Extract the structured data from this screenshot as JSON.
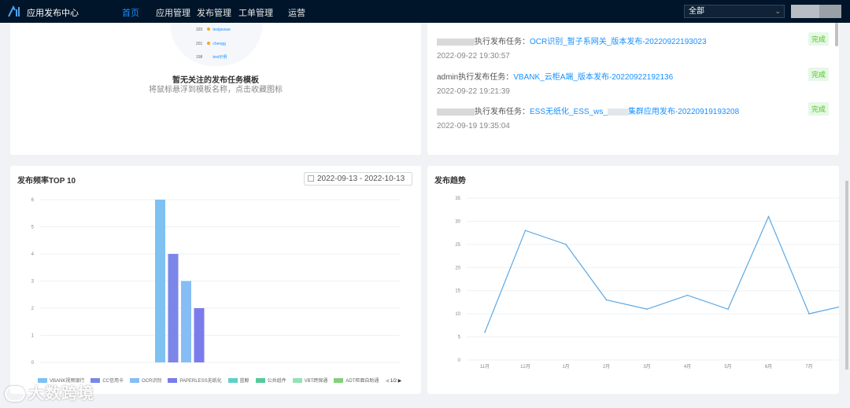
{
  "header": {
    "app_title": "应用发布中心",
    "nav": [
      "首页",
      "应用管理",
      "发布管理",
      "工单管理",
      "运营"
    ],
    "active_nav": "首页",
    "select_value": "全部"
  },
  "illustration": {
    "rows": [
      {
        "num": "320",
        "name": "testjavase"
      },
      {
        "num": "201",
        "name": "chengg"
      },
      {
        "num": "198",
        "name": "test示例"
      }
    ]
  },
  "empty_state": {
    "title": "暂无关注的发布任务模板",
    "subtitle": "将鼠标悬浮到模板名称，点击收藏图标"
  },
  "tasks": [
    {
      "user": "",
      "action": "执行发布任务：",
      "link": "OCR识别_暂子系网关_版本发布-20220922193023",
      "time": "2022-09-22 19:30:57",
      "status": "完成"
    },
    {
      "user": "admin",
      "action": "执行发布任务：",
      "link": "VBANK_云柜A端_版本发布-20220922192136",
      "time": "2022-09-22 19:21:39",
      "status": "完成"
    },
    {
      "user": "",
      "action": "执行发布任务：",
      "link_prefix": "ESS无纸化_ESS_ws_",
      "link_suffix": "集群应用发布-20220919193208",
      "time": "2022-09-19 19:35:04",
      "status": "完成"
    }
  ],
  "top10": {
    "title": "发布频率TOP 10",
    "date_range": "2022-09-13 - 2022-10-13",
    "pager": "1/2"
  },
  "trend": {
    "title": "发布趋势"
  },
  "chart_data": [
    {
      "type": "bar",
      "title": "发布频率TOP 10",
      "categories": [
        "VBANK视频银行",
        "CC信用卡",
        "OCR识别",
        "PAPERLESS无纸化",
        "蓝鲸",
        "公共组件",
        "VBT跨保通",
        "ADT柜面自助通"
      ],
      "values": [
        6,
        4,
        3,
        2,
        null,
        null,
        null,
        null
      ],
      "colors": [
        "#7ec1f2",
        "#7b86e8",
        "#86bdf5",
        "#7a7cec",
        "#5fd0c9",
        "#58c99a",
        "#94e2b6",
        "#85cf7c"
      ],
      "ylim": [
        0,
        6
      ],
      "yticks": [
        0,
        1,
        2,
        3,
        4,
        5,
        6
      ],
      "legend_position": "bottom",
      "grid": true
    },
    {
      "type": "line",
      "title": "发布趋势",
      "x": [
        "11月",
        "12月",
        "1月",
        "2月",
        "3月",
        "4月",
        "5月",
        "6月",
        "7月",
        "8月"
      ],
      "values": [
        6,
        28,
        25,
        13,
        11,
        14,
        11,
        31,
        10,
        12
      ],
      "color": "#5aa8e6",
      "ylim": [
        0,
        35
      ],
      "yticks": [
        0,
        5,
        10,
        15,
        20,
        25,
        30,
        35
      ],
      "grid": true
    }
  ],
  "watermark": "大数跨境"
}
